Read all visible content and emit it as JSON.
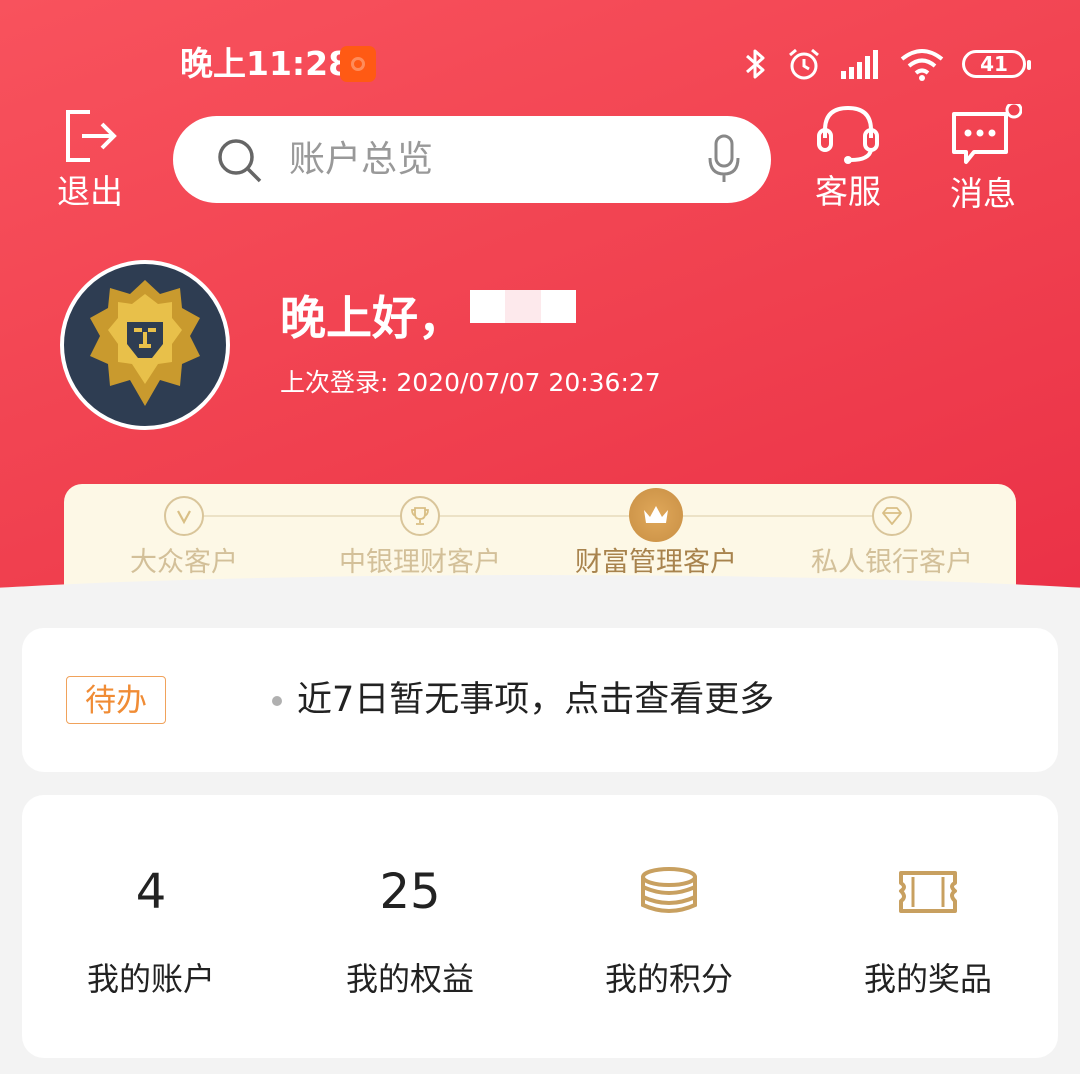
{
  "status_bar": {
    "time": "晚上11:28",
    "battery": "41"
  },
  "top_nav": {
    "logout_label": "退出",
    "search_placeholder": "账户总览",
    "service_label": "客服",
    "message_label": "消息"
  },
  "user": {
    "greeting": "晚上好，",
    "last_login": "上次登录: 2020/07/07 20:36:27"
  },
  "tiers": [
    {
      "label": "大众客户",
      "active": false
    },
    {
      "label": "中银理财客户",
      "active": false
    },
    {
      "label": "财富管理客户",
      "active": true
    },
    {
      "label": "私人银行客户",
      "active": false
    }
  ],
  "todo": {
    "tag": "待办",
    "text": "近7日暂无事项，点击查看更多"
  },
  "stats": [
    {
      "value": "4",
      "label": "我的账户"
    },
    {
      "value": "25",
      "label": "我的权益"
    },
    {
      "icon": "coins-icon",
      "label": "我的积分"
    },
    {
      "icon": "ticket-icon",
      "label": "我的奖品"
    }
  ],
  "colors": {
    "header_red": "#f0404f",
    "gold": "#c8a060",
    "todo_orange": "#f08c35"
  }
}
